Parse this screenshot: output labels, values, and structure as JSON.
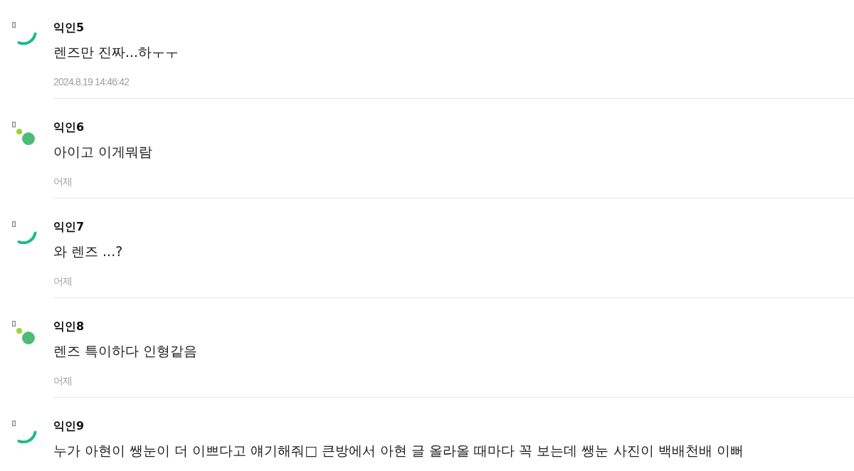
{
  "comments": [
    {
      "author": "익인5",
      "kind": "arc",
      "text": "렌즈만 진짜...하ㅜㅜ",
      "time": "2024.8.19 14:46:42"
    },
    {
      "author": "익인6",
      "kind": "dots",
      "text": "아이고 이게뭐람",
      "time": "어제"
    },
    {
      "author": "익인7",
      "kind": "arc",
      "text": "와 렌즈 ...?",
      "time": "어제"
    },
    {
      "author": "익인8",
      "kind": "dots",
      "text": "렌즈 특이하다 인형같음",
      "time": "어제"
    },
    {
      "author": "익인9",
      "kind": "arc",
      "text": "누가 아현이 쌩눈이 더 이쁘다고 얘기해줘□ 큰방에서 아현 글 올라올 때마다 꼭 보는데 쌩눈 사진이 백배천배 이뻐"
    }
  ]
}
